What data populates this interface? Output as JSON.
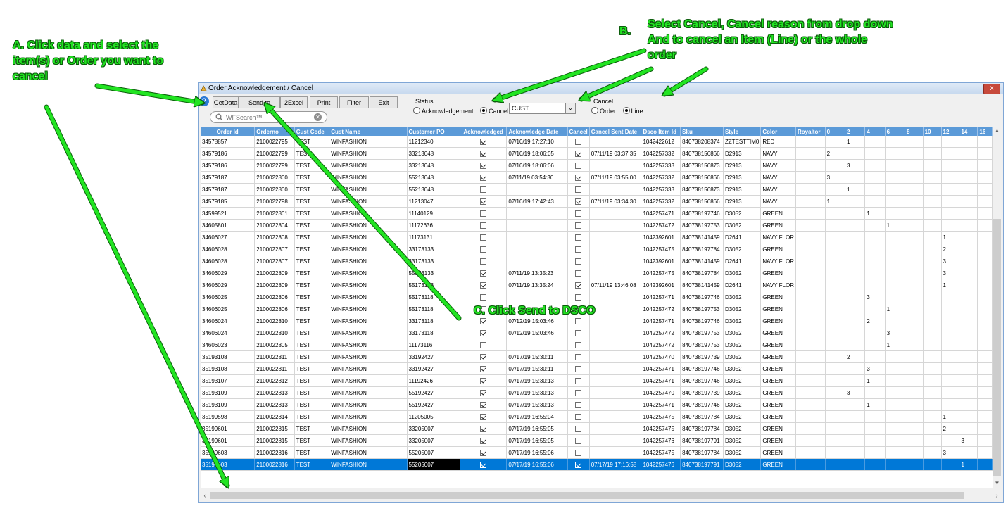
{
  "annotations": {
    "a_line1": "A. Click data and select the",
    "a_line2": "item(s) or Order you want to",
    "a_line3": "cancel",
    "b_letter": "B.",
    "b_line1": "Select Cancel,  Cancel reason from drop down",
    "b_line2": "And to cancel an Item (Line) or the whole",
    "b_line3": "order",
    "c_text": "C. Click Send to DSCO"
  },
  "window": {
    "title": "Order Acknowledgement / Cancel",
    "close_label": "x"
  },
  "toolbar": {
    "getdata": "GetData",
    "send_dsco": "Send to DSCO",
    "excel": "2Excel",
    "print": "Print",
    "filter": "Filter",
    "exit": "Exit"
  },
  "search": {
    "placeholder": "WFSearch™"
  },
  "status_group": {
    "label": "Status",
    "opt_ack": "Acknowledgement",
    "opt_cancel": "Cancel",
    "selected": "Cancel"
  },
  "cancel_reason": {
    "value": "CUST"
  },
  "cancel_group": {
    "label": "Cancel",
    "opt_order": "Order",
    "opt_line": "Line",
    "selected": "Line"
  },
  "grid": {
    "columns": [
      "Order Id",
      "Orderno",
      "Cust Code",
      "Cust Name",
      "Customer PO",
      "Acknowledged",
      "Acknowledge Date",
      "Cancel",
      "Cancel Sent Date",
      "Dsco Item Id",
      "Sku",
      "Style",
      "Color",
      "Royaltor",
      "0",
      "2",
      "4",
      "6",
      "8",
      "10",
      "12",
      "14",
      "16"
    ],
    "rows": [
      {
        "order_id": "34578857",
        "orderno": "2100022795",
        "cust_code": "TEST",
        "cust_name": "WINFASHION",
        "po": "11212340",
        "ack": true,
        "ack_date": "07/10/19 17:27:10",
        "cancel": false,
        "cancel_date": "",
        "item": "1042422612",
        "sku": "840738208374",
        "style": "ZZTESTTIM0",
        "color": "RED",
        "royal": "",
        "s0": "",
        "s2": "1",
        "s4": "",
        "s6": "",
        "s8": "",
        "s10": "",
        "s12": "",
        "s14": "",
        "s16": ""
      },
      {
        "order_id": "34579186",
        "orderno": "2100022799",
        "cust_code": "TEST",
        "cust_name": "WINFASHION",
        "po": "33213048",
        "ack": true,
        "ack_date": "07/10/19 18:06:05",
        "cancel": true,
        "cancel_date": "07/11/19 03:37:35",
        "item": "1042257332",
        "sku": "840738156866",
        "style": "D2913",
        "color": "NAVY",
        "royal": "",
        "s0": "2",
        "s2": "",
        "s4": "",
        "s6": "",
        "s8": "",
        "s10": "",
        "s12": "",
        "s14": "",
        "s16": ""
      },
      {
        "order_id": "34579186",
        "orderno": "2100022799",
        "cust_code": "TEST",
        "cust_name": "WINFASHION",
        "po": "33213048",
        "ack": true,
        "ack_date": "07/10/19 18:06:06",
        "cancel": false,
        "cancel_date": "",
        "item": "1042257333",
        "sku": "840738156873",
        "style": "D2913",
        "color": "NAVY",
        "royal": "",
        "s0": "",
        "s2": "3",
        "s4": "",
        "s6": "",
        "s8": "",
        "s10": "",
        "s12": "",
        "s14": "",
        "s16": ""
      },
      {
        "order_id": "34579187",
        "orderno": "2100022800",
        "cust_code": "TEST",
        "cust_name": "WINFASHION",
        "po": "55213048",
        "ack": true,
        "ack_date": "07/11/19 03:54:30",
        "cancel": true,
        "cancel_date": "07/11/19 03:55:00",
        "item": "1042257332",
        "sku": "840738156866",
        "style": "D2913",
        "color": "NAVY",
        "royal": "",
        "s0": "3",
        "s2": "",
        "s4": "",
        "s6": "",
        "s8": "",
        "s10": "",
        "s12": "",
        "s14": "",
        "s16": ""
      },
      {
        "order_id": "34579187",
        "orderno": "2100022800",
        "cust_code": "TEST",
        "cust_name": "WINFASHION",
        "po": "55213048",
        "ack": false,
        "ack_date": "",
        "cancel": false,
        "cancel_date": "",
        "item": "1042257333",
        "sku": "840738156873",
        "style": "D2913",
        "color": "NAVY",
        "royal": "",
        "s0": "",
        "s2": "1",
        "s4": "",
        "s6": "",
        "s8": "",
        "s10": "",
        "s12": "",
        "s14": "",
        "s16": ""
      },
      {
        "order_id": "34579185",
        "orderno": "2100022798",
        "cust_code": "TEST",
        "cust_name": "WINFASHION",
        "po": "11213047",
        "ack": true,
        "ack_date": "07/10/19 17:42:43",
        "cancel": true,
        "cancel_date": "07/11/19 03:34:30",
        "item": "1042257332",
        "sku": "840738156866",
        "style": "D2913",
        "color": "NAVY",
        "royal": "",
        "s0": "1",
        "s2": "",
        "s4": "",
        "s6": "",
        "s8": "",
        "s10": "",
        "s12": "",
        "s14": "",
        "s16": ""
      },
      {
        "order_id": "34599521",
        "orderno": "2100022801",
        "cust_code": "TEST",
        "cust_name": "WINFASHION",
        "po": "11140129",
        "ack": false,
        "ack_date": "",
        "cancel": false,
        "cancel_date": "",
        "item": "1042257471",
        "sku": "840738197746",
        "style": "D3052",
        "color": "GREEN",
        "royal": "",
        "s0": "",
        "s2": "",
        "s4": "1",
        "s6": "",
        "s8": "",
        "s10": "",
        "s12": "",
        "s14": "",
        "s16": ""
      },
      {
        "order_id": "34605801",
        "orderno": "2100022804",
        "cust_code": "TEST",
        "cust_name": "WINFASHION",
        "po": "11172636",
        "ack": false,
        "ack_date": "",
        "cancel": false,
        "cancel_date": "",
        "item": "1042257472",
        "sku": "840738197753",
        "style": "D3052",
        "color": "GREEN",
        "royal": "",
        "s0": "",
        "s2": "",
        "s4": "",
        "s6": "1",
        "s8": "",
        "s10": "",
        "s12": "",
        "s14": "",
        "s16": ""
      },
      {
        "order_id": "34606027",
        "orderno": "2100022808",
        "cust_code": "TEST",
        "cust_name": "WINFASHION",
        "po": "11173131",
        "ack": false,
        "ack_date": "",
        "cancel": false,
        "cancel_date": "",
        "item": "1042392601",
        "sku": "840738141459",
        "style": "D2641",
        "color": "NAVY FLOR",
        "royal": "",
        "s0": "",
        "s2": "",
        "s4": "",
        "s6": "",
        "s8": "",
        "s10": "",
        "s12": "1",
        "s14": "",
        "s16": ""
      },
      {
        "order_id": "34606028",
        "orderno": "2100022807",
        "cust_code": "TEST",
        "cust_name": "WINFASHION",
        "po": "33173133",
        "ack": false,
        "ack_date": "",
        "cancel": false,
        "cancel_date": "",
        "item": "1042257475",
        "sku": "840738197784",
        "style": "D3052",
        "color": "GREEN",
        "royal": "",
        "s0": "",
        "s2": "",
        "s4": "",
        "s6": "",
        "s8": "",
        "s10": "",
        "s12": "2",
        "s14": "",
        "s16": ""
      },
      {
        "order_id": "34606028",
        "orderno": "2100022807",
        "cust_code": "TEST",
        "cust_name": "WINFASHION",
        "po": "33173133",
        "ack": false,
        "ack_date": "",
        "cancel": false,
        "cancel_date": "",
        "item": "1042392601",
        "sku": "840738141459",
        "style": "D2641",
        "color": "NAVY FLOR",
        "royal": "",
        "s0": "",
        "s2": "",
        "s4": "",
        "s6": "",
        "s8": "",
        "s10": "",
        "s12": "3",
        "s14": "",
        "s16": ""
      },
      {
        "order_id": "34606029",
        "orderno": "2100022809",
        "cust_code": "TEST",
        "cust_name": "WINFASHION",
        "po": "55173133",
        "ack": true,
        "ack_date": "07/11/19 13:35:23",
        "cancel": false,
        "cancel_date": "",
        "item": "1042257475",
        "sku": "840738197784",
        "style": "D3052",
        "color": "GREEN",
        "royal": "",
        "s0": "",
        "s2": "",
        "s4": "",
        "s6": "",
        "s8": "",
        "s10": "",
        "s12": "3",
        "s14": "",
        "s16": ""
      },
      {
        "order_id": "34606029",
        "orderno": "2100022809",
        "cust_code": "TEST",
        "cust_name": "WINFASHION",
        "po": "55173133",
        "ack": true,
        "ack_date": "07/11/19 13:35:24",
        "cancel": true,
        "cancel_date": "07/11/19 13:46:08",
        "item": "1042392601",
        "sku": "840738141459",
        "style": "D2641",
        "color": "NAVY FLOR",
        "royal": "",
        "s0": "",
        "s2": "",
        "s4": "",
        "s6": "",
        "s8": "",
        "s10": "",
        "s12": "1",
        "s14": "",
        "s16": ""
      },
      {
        "order_id": "34606025",
        "orderno": "2100022806",
        "cust_code": "TEST",
        "cust_name": "WINFASHION",
        "po": "55173118",
        "ack": false,
        "ack_date": "",
        "cancel": false,
        "cancel_date": "",
        "item": "1042257471",
        "sku": "840738197746",
        "style": "D3052",
        "color": "GREEN",
        "royal": "",
        "s0": "",
        "s2": "",
        "s4": "3",
        "s6": "",
        "s8": "",
        "s10": "",
        "s12": "",
        "s14": "",
        "s16": ""
      },
      {
        "order_id": "34606025",
        "orderno": "2100022806",
        "cust_code": "TEST",
        "cust_name": "WINFASHION",
        "po": "55173118",
        "ack": false,
        "ack_date": "",
        "cancel": false,
        "cancel_date": "",
        "item": "1042257472",
        "sku": "840738197753",
        "style": "D3052",
        "color": "GREEN",
        "royal": "",
        "s0": "",
        "s2": "",
        "s4": "",
        "s6": "1",
        "s8": "",
        "s10": "",
        "s12": "",
        "s14": "",
        "s16": ""
      },
      {
        "order_id": "34606024",
        "orderno": "2100022810",
        "cust_code": "TEST",
        "cust_name": "WINFASHION",
        "po": "33173118",
        "ack": true,
        "ack_date": "07/12/19 15:03:46",
        "cancel": false,
        "cancel_date": "",
        "item": "1042257471",
        "sku": "840738197746",
        "style": "D3052",
        "color": "GREEN",
        "royal": "",
        "s0": "",
        "s2": "",
        "s4": "2",
        "s6": "",
        "s8": "",
        "s10": "",
        "s12": "",
        "s14": "",
        "s16": ""
      },
      {
        "order_id": "34606024",
        "orderno": "2100022810",
        "cust_code": "TEST",
        "cust_name": "WINFASHION",
        "po": "33173118",
        "ack": true,
        "ack_date": "07/12/19 15:03:46",
        "cancel": false,
        "cancel_date": "",
        "item": "1042257472",
        "sku": "840738197753",
        "style": "D3052",
        "color": "GREEN",
        "royal": "",
        "s0": "",
        "s2": "",
        "s4": "",
        "s6": "3",
        "s8": "",
        "s10": "",
        "s12": "",
        "s14": "",
        "s16": ""
      },
      {
        "order_id": "34606023",
        "orderno": "2100022805",
        "cust_code": "TEST",
        "cust_name": "WINFASHION",
        "po": "11173116",
        "ack": false,
        "ack_date": "",
        "cancel": false,
        "cancel_date": "",
        "item": "1042257472",
        "sku": "840738197753",
        "style": "D3052",
        "color": "GREEN",
        "royal": "",
        "s0": "",
        "s2": "",
        "s4": "",
        "s6": "1",
        "s8": "",
        "s10": "",
        "s12": "",
        "s14": "",
        "s16": ""
      },
      {
        "order_id": "35193108",
        "orderno": "2100022811",
        "cust_code": "TEST",
        "cust_name": "WINFASHION",
        "po": "33192427",
        "ack": true,
        "ack_date": "07/17/19 15:30:11",
        "cancel": false,
        "cancel_date": "",
        "item": "1042257470",
        "sku": "840738197739",
        "style": "D3052",
        "color": "GREEN",
        "royal": "",
        "s0": "",
        "s2": "2",
        "s4": "",
        "s6": "",
        "s8": "",
        "s10": "",
        "s12": "",
        "s14": "",
        "s16": ""
      },
      {
        "order_id": "35193108",
        "orderno": "2100022811",
        "cust_code": "TEST",
        "cust_name": "WINFASHION",
        "po": "33192427",
        "ack": true,
        "ack_date": "07/17/19 15:30:11",
        "cancel": false,
        "cancel_date": "",
        "item": "1042257471",
        "sku": "840738197746",
        "style": "D3052",
        "color": "GREEN",
        "royal": "",
        "s0": "",
        "s2": "",
        "s4": "3",
        "s6": "",
        "s8": "",
        "s10": "",
        "s12": "",
        "s14": "",
        "s16": ""
      },
      {
        "order_id": "35193107",
        "orderno": "2100022812",
        "cust_code": "TEST",
        "cust_name": "WINFASHION",
        "po": "11192426",
        "ack": true,
        "ack_date": "07/17/19 15:30:13",
        "cancel": false,
        "cancel_date": "",
        "item": "1042257471",
        "sku": "840738197746",
        "style": "D3052",
        "color": "GREEN",
        "royal": "",
        "s0": "",
        "s2": "",
        "s4": "1",
        "s6": "",
        "s8": "",
        "s10": "",
        "s12": "",
        "s14": "",
        "s16": ""
      },
      {
        "order_id": "35193109",
        "orderno": "2100022813",
        "cust_code": "TEST",
        "cust_name": "WINFASHION",
        "po": "55192427",
        "ack": true,
        "ack_date": "07/17/19 15:30:13",
        "cancel": false,
        "cancel_date": "",
        "item": "1042257470",
        "sku": "840738197739",
        "style": "D3052",
        "color": "GREEN",
        "royal": "",
        "s0": "",
        "s2": "3",
        "s4": "",
        "s6": "",
        "s8": "",
        "s10": "",
        "s12": "",
        "s14": "",
        "s16": ""
      },
      {
        "order_id": "35193109",
        "orderno": "2100022813",
        "cust_code": "TEST",
        "cust_name": "WINFASHION",
        "po": "55192427",
        "ack": true,
        "ack_date": "07/17/19 15:30:13",
        "cancel": false,
        "cancel_date": "",
        "item": "1042257471",
        "sku": "840738197746",
        "style": "D3052",
        "color": "GREEN",
        "royal": "",
        "s0": "",
        "s2": "",
        "s4": "1",
        "s6": "",
        "s8": "",
        "s10": "",
        "s12": "",
        "s14": "",
        "s16": ""
      },
      {
        "order_id": "35199598",
        "orderno": "2100022814",
        "cust_code": "TEST",
        "cust_name": "WINFASHION",
        "po": "11205005",
        "ack": true,
        "ack_date": "07/17/19 16:55:04",
        "cancel": false,
        "cancel_date": "",
        "item": "1042257475",
        "sku": "840738197784",
        "style": "D3052",
        "color": "GREEN",
        "royal": "",
        "s0": "",
        "s2": "",
        "s4": "",
        "s6": "",
        "s8": "",
        "s10": "",
        "s12": "1",
        "s14": "",
        "s16": ""
      },
      {
        "order_id": "35199601",
        "orderno": "2100022815",
        "cust_code": "TEST",
        "cust_name": "WINFASHION",
        "po": "33205007",
        "ack": true,
        "ack_date": "07/17/19 16:55:05",
        "cancel": false,
        "cancel_date": "",
        "item": "1042257475",
        "sku": "840738197784",
        "style": "D3052",
        "color": "GREEN",
        "royal": "",
        "s0": "",
        "s2": "",
        "s4": "",
        "s6": "",
        "s8": "",
        "s10": "",
        "s12": "2",
        "s14": "",
        "s16": ""
      },
      {
        "order_id": "35199601",
        "orderno": "2100022815",
        "cust_code": "TEST",
        "cust_name": "WINFASHION",
        "po": "33205007",
        "ack": true,
        "ack_date": "07/17/19 16:55:05",
        "cancel": false,
        "cancel_date": "",
        "item": "1042257476",
        "sku": "840738197791",
        "style": "D3052",
        "color": "GREEN",
        "royal": "",
        "s0": "",
        "s2": "",
        "s4": "",
        "s6": "",
        "s8": "",
        "s10": "",
        "s12": "",
        "s14": "3",
        "s16": ""
      },
      {
        "order_id": "35199603",
        "orderno": "2100022816",
        "cust_code": "TEST",
        "cust_name": "WINFASHION",
        "po": "55205007",
        "ack": true,
        "ack_date": "07/17/19 16:55:06",
        "cancel": false,
        "cancel_date": "",
        "item": "1042257475",
        "sku": "840738197784",
        "style": "D3052",
        "color": "GREEN",
        "royal": "",
        "s0": "",
        "s2": "",
        "s4": "",
        "s6": "",
        "s8": "",
        "s10": "",
        "s12": "3",
        "s14": "",
        "s16": ""
      },
      {
        "order_id": "35199603",
        "orderno": "2100022816",
        "cust_code": "TEST",
        "cust_name": "WINFASHION",
        "po": "55205007",
        "ack": true,
        "ack_date": "07/17/19 16:55:06",
        "cancel": true,
        "cancel_date": "07/17/19 17:16:58",
        "item": "1042257476",
        "sku": "840738197791",
        "style": "D3052",
        "color": "GREEN",
        "royal": "",
        "s0": "",
        "s2": "",
        "s4": "",
        "s6": "",
        "s8": "",
        "s10": "",
        "s12": "",
        "s14": "1",
        "s16": "",
        "selected": true
      }
    ]
  },
  "colors": {
    "annotation_green": "#22e422",
    "header_blue": "#5b9ad8",
    "selection_blue": "#0078d7"
  }
}
